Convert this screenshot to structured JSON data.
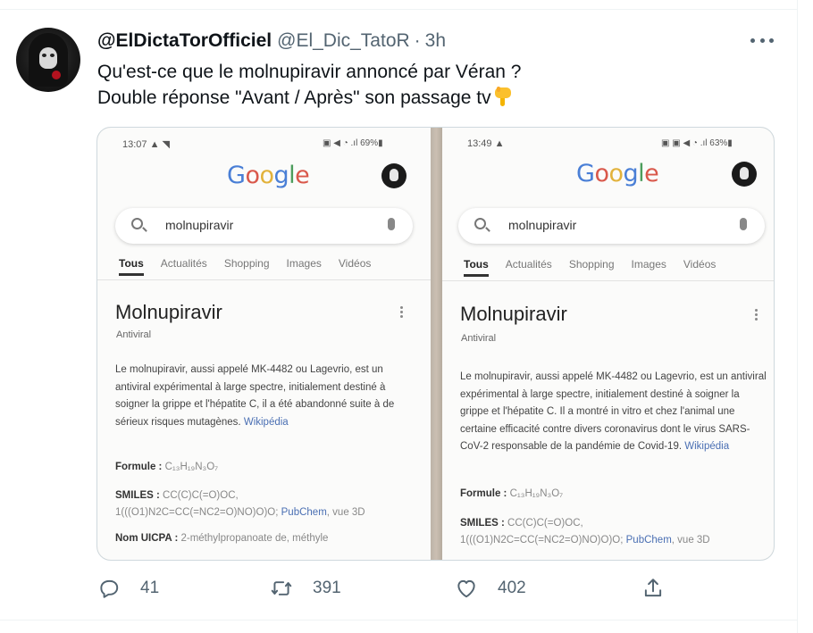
{
  "tweet": {
    "display_name": "@ElDictaTorOfficiel",
    "handle": "@El_Dic_TatoR",
    "separator": "·",
    "time": "3h",
    "text_line1": "Qu'est-ce que le molnupiravir annoncé par Véran ?",
    "text_line2": "Double réponse \"Avant / Après\" son passage tv",
    "emoji": "pointing-down-hand-icon"
  },
  "media": {
    "left": {
      "status_time": "13:07 ▲ ◥",
      "status_right": "▣ ◀ ◔ .ıl 69%▮",
      "search_query": "molnupiravir",
      "tabs": [
        "Tous",
        "Actualités",
        "Shopping",
        "Images",
        "Vidéos"
      ],
      "title": "Molnupiravir",
      "subtitle": "Antiviral",
      "description": "Le molnupiravir, aussi appelé MK-4482 ou Lagevrio, est un antiviral expérimental à large spectre, initialement destiné à soigner la grippe et l'hépatite C, il a été abandonné suite à de sérieux risques mutagènes.",
      "wiki": "Wikipédia",
      "formula_label": "Formule :",
      "formula_value": "C₁₃H₁₉N₃O₇",
      "smiles_label": "SMILES :",
      "smiles_value_1": "CC(C)C(=O)OC,",
      "smiles_value_2": "1(((O1)N2C=CC(=NC2=O)NO)O)O;",
      "smiles_link": "PubChem",
      "smiles_suffix": ", vue 3D",
      "iupac_label": "Nom UICPA :",
      "iupac_value": "2-méthylpropanoate de, méthyle"
    },
    "right": {
      "status_time": "13:49 ▲",
      "status_right": "▣ ▣ ◀ ◔ .ıl 63%▮",
      "search_query": "molnupiravir",
      "tabs": [
        "Tous",
        "Actualités",
        "Shopping",
        "Images",
        "Vidéos"
      ],
      "title": "Molnupiravir",
      "subtitle": "Antiviral",
      "description": "Le molnupiravir, aussi appelé MK-4482 ou Lagevrio, est un antiviral expérimental à large spectre, initialement destiné à soigner la grippe et l'hépatite C. Il a montré in vitro et chez l'animal une certaine efficacité contre divers coronavirus dont le virus SARS-CoV-2 responsable de la pandémie de Covid-19.",
      "wiki": "Wikipédia",
      "formula_label": "Formule :",
      "formula_value": "C₁₃H₁₉N₃O₇",
      "smiles_label": "SMILES :",
      "smiles_value_1": "CC(C)C(=O)OC,",
      "smiles_value_2": "1(((O1)N2C=CC(=NC2=O)NO)O)O;",
      "smiles_link": "PubChem",
      "smiles_suffix": ", vue 3D"
    }
  },
  "actions": {
    "reply_count": "41",
    "retweet_count": "391",
    "like_count": "402"
  }
}
